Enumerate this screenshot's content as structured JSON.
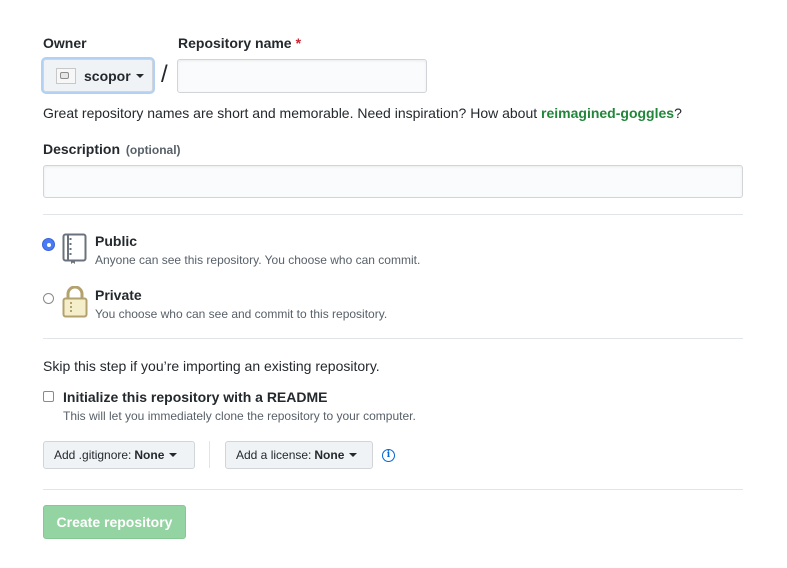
{
  "owner": {
    "label": "Owner",
    "value": "scopor"
  },
  "repo_name": {
    "label": "Repository name",
    "required_mark": "*",
    "value": ""
  },
  "separator": "/",
  "hint": {
    "prefix": "Great repository names are short and memorable. Need inspiration? How about ",
    "suggestion": "reimagined-goggles",
    "suffix": "?"
  },
  "description": {
    "label": "Description",
    "optional": "(optional)",
    "value": ""
  },
  "visibility": {
    "selected": "public",
    "options": [
      {
        "title": "Public",
        "desc": "Anyone can see this repository. You choose who can commit.",
        "icon": "repo-icon"
      },
      {
        "title": "Private",
        "desc": "You choose who can see and commit to this repository.",
        "icon": "lock-icon"
      }
    ]
  },
  "import_note": "Skip this step if you’re importing an existing repository.",
  "readme": {
    "label": "Initialize this repository with a README",
    "desc": "This will let you immediately clone the repository to your computer.",
    "checked": false
  },
  "gitignore": {
    "label": "Add .gitignore:",
    "value": "None"
  },
  "license": {
    "label": "Add a license:",
    "value": "None"
  },
  "info_icon": "info-icon",
  "submit": {
    "label": "Create repository",
    "disabled": true
  },
  "colors": {
    "suggestion": "#22863a",
    "submit_bg": "#94d3a2",
    "radio_selected": "#4a7bf7",
    "info": "#0366d6"
  }
}
